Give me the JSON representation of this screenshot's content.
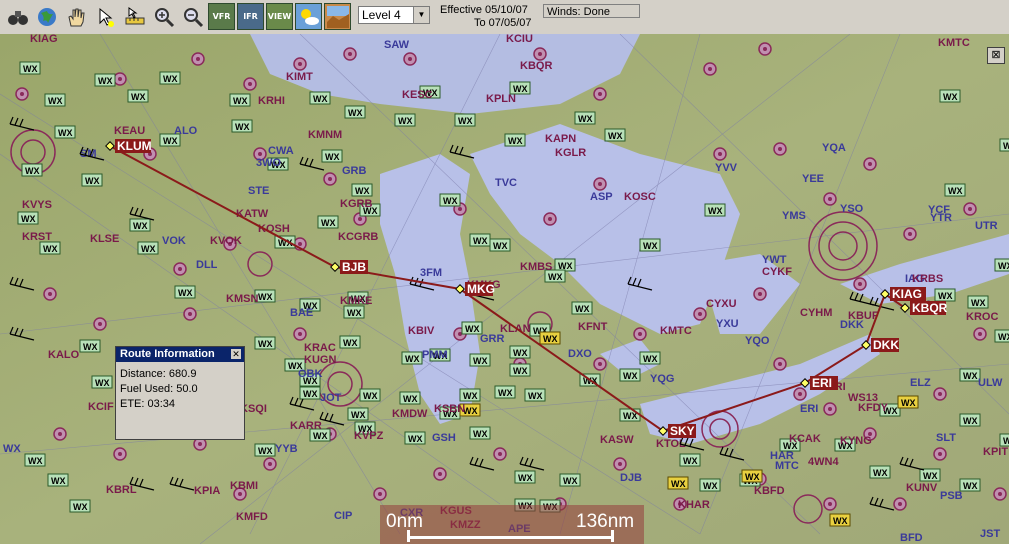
{
  "toolbar": {
    "tools": [
      {
        "name": "binoculars-icon"
      },
      {
        "name": "globe-icon"
      },
      {
        "name": "hand-pan-icon"
      },
      {
        "name": "pointer-icon"
      },
      {
        "name": "ruler-icon"
      },
      {
        "name": "zoom-in-icon"
      },
      {
        "name": "zoom-out-icon"
      },
      {
        "name": "vfr-chart-button",
        "label": "VFR"
      },
      {
        "name": "ifr-chart-button",
        "label": "IFR"
      },
      {
        "name": "view-button",
        "label": "VIEW"
      },
      {
        "name": "weather-button"
      },
      {
        "name": "terrain-button"
      }
    ],
    "level_select": "Level 4",
    "effective_line1": "Effective 05/10/07",
    "effective_line2": "To 07/05/07",
    "winds_status": "Winds: Done"
  },
  "route_popup": {
    "title": "Route Information",
    "distance": "Distance: 680.9",
    "fuel": "Fuel Used: 50.0",
    "ete": "ETE: 03:34"
  },
  "scale_bar": {
    "left_label": "0nm",
    "right_label": "136nm"
  },
  "waypoints": [
    "KLUM",
    "BJB",
    "MKG",
    "SKY",
    "ERI",
    "DKK",
    "KIAG",
    "KBQR"
  ],
  "map_labels": [
    "SAW",
    "KCIU",
    "KESC",
    "KPLN",
    "KIMT",
    "KRHI",
    "KMNM",
    "KAPN",
    "KGLR",
    "CWA",
    "GRB",
    "3WO",
    "STE",
    "KGRB",
    "KATW",
    "KOSH",
    "KCGRB",
    "TVC",
    "YVV",
    "YQA",
    "YEE",
    "KOSC",
    "ASP",
    "YMS",
    "YSO",
    "YCF",
    "YTR",
    "UTR",
    "KRST",
    "KLSE",
    "VOK",
    "KVOK",
    "DLL",
    "YWT",
    "CYKF",
    "KMBS",
    "3FM",
    "KMKG",
    "KMSN",
    "BAE",
    "KMKE",
    "KBIV",
    "KLAN",
    "KFNT",
    "KMTC",
    "CYXU",
    "YXU",
    "CYHM",
    "KBUF",
    "IAG",
    "KROC",
    "KALO",
    "KRAC",
    "KUGN",
    "OBK",
    "PMM",
    "GRR",
    "DXO",
    "YQG",
    "YQO",
    "DKK",
    "KFRI",
    "KCIF",
    "IOW",
    "KSQI",
    "KARR",
    "JOT",
    "KMDW",
    "KSBN",
    "KVPZ",
    "GSH",
    "KASW",
    "KTOL",
    "DJB",
    "KFDY",
    "KBFD",
    "KCAK",
    "KYNG",
    "KPIT",
    "KBRL",
    "KPIA",
    "KBMI",
    "KMFD",
    "KGUS",
    "KMZZ",
    "APE",
    "KHAR",
    "JST",
    "BFD",
    "SLT",
    "KUNV",
    "PSB",
    "ELZ",
    "ULW",
    "ERI",
    "WS13",
    "4WN4",
    "KEAU",
    "ALO",
    "SM",
    "KVYS",
    "WX",
    "YYB",
    "KIAG",
    "KBQR",
    "KMTC",
    "KRBS",
    "DPA",
    "CXR",
    "CIP",
    "MTC",
    "HAR"
  ],
  "colors": {
    "route": "#8b1a1a",
    "waypoint": "#ffff66",
    "land": "#a9b47a",
    "lake": "#b8c0e8",
    "airspace": "#8a2a5a"
  }
}
